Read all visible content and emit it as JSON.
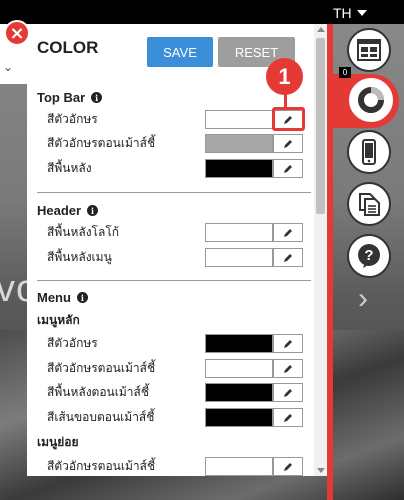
{
  "background": {
    "language": "TH",
    "hero_text": "vo",
    "colors": {
      "accent": "#e53935",
      "save": "#3b8fd9",
      "reset": "#9e9e9e"
    }
  },
  "toolbar": {
    "badge": "0",
    "buttons": [
      {
        "name": "layout-icon"
      },
      {
        "name": "color-ring-icon"
      },
      {
        "name": "mobile-icon"
      },
      {
        "name": "copy-pages-icon"
      },
      {
        "name": "help-icon"
      }
    ]
  },
  "panel": {
    "close_label": "×",
    "title": "COLOR",
    "save_label": "SAVE",
    "reset_label": "RESET",
    "callout_number": "1",
    "sections": {
      "top_bar": {
        "title": "Top Bar",
        "rows": [
          {
            "label": "สีตัวอักษร",
            "color": "#ffffff"
          },
          {
            "label": "สีตัวอักษรตอนเม้าส์ชี้",
            "color": "#a8a8a8"
          },
          {
            "label": "สีพื้นหลัง",
            "color": "#000000"
          }
        ]
      },
      "header": {
        "title": "Header",
        "rows": [
          {
            "label": "สีพื้นหลังโลโก้",
            "color": "#ffffff"
          },
          {
            "label": "สีพื้นหลังเมนู",
            "color": "#ffffff"
          }
        ]
      },
      "menu": {
        "title": "Menu",
        "main_menu": {
          "title": "เมนูหลัก",
          "rows": [
            {
              "label": "สีตัวอักษร",
              "color": "#000000"
            },
            {
              "label": "สีตัวอักษรตอนเม้าส์ชี้",
              "color": "#ffffff"
            },
            {
              "label": "สีพื้นหลังตอนเม้าส์ชี้",
              "color": "#000000"
            },
            {
              "label": "สีเส้นขอบตอนเม้าส์ชี้",
              "color": "#000000"
            }
          ]
        },
        "sub_menu": {
          "title": "เมนูย่อย",
          "rows": [
            {
              "label": "สีตัวอักษรตอนเม้าส์ชี้",
              "color": "#ffffff"
            }
          ]
        }
      }
    }
  }
}
